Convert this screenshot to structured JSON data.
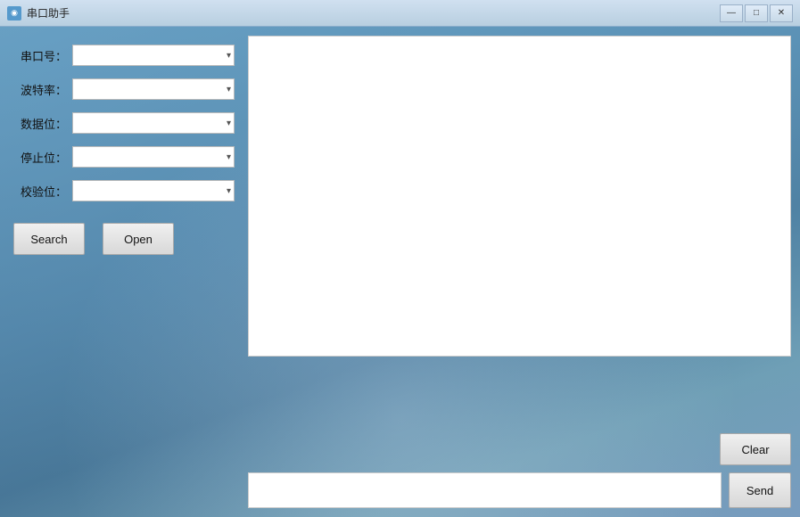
{
  "window": {
    "title": "串口助手",
    "title_icon": "◉"
  },
  "titlebar": {
    "minimize_label": "—",
    "maximize_label": "□",
    "close_label": "✕"
  },
  "form": {
    "serial_port_label": "串口号：",
    "baud_rate_label": "波特率：",
    "data_bits_label": "数据位：",
    "stop_bits_label": "停止位：",
    "parity_label": "校验位："
  },
  "buttons": {
    "search_label": "Search",
    "open_label": "Open",
    "clear_label": "Clear",
    "send_label": "Send"
  },
  "send_input": {
    "placeholder": "",
    "value": ""
  },
  "text_display": {
    "value": ""
  }
}
